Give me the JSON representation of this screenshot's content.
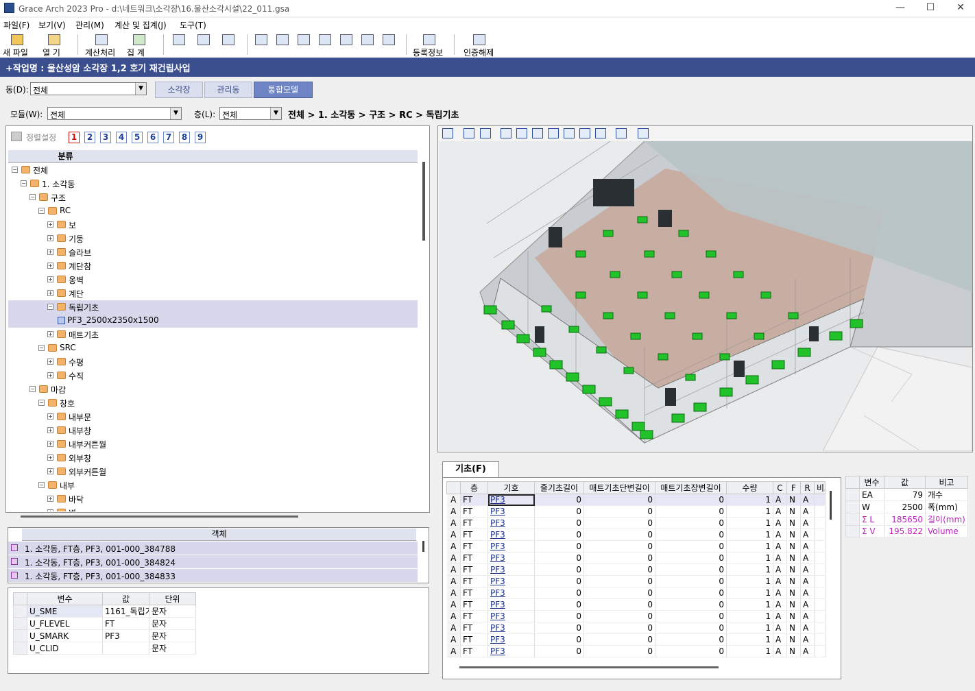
{
  "window": {
    "title": "Grace Arch 2023 Pro - d:\\네트워크\\소각장\\16.울산소각시설\\22_011.gsa",
    "minimize": "—",
    "maximize": "☐",
    "close": "✕"
  },
  "menu": [
    "파일(F)",
    "보기(V)",
    "관리(M)",
    "계산 및 집계(J)",
    "도구(T)"
  ],
  "toolbar": {
    "new_file": "새 파일",
    "open": "열  기",
    "calculate": "계산처리",
    "aggregate": "집  계",
    "register_info": "등록정보",
    "unauthorize": "인증해제"
  },
  "project": "+작업명 : 울산성암 소각장 1,2 호기 재건립사업",
  "building": {
    "label": "동(D):",
    "value": "전체"
  },
  "tabs": [
    "소각장",
    "관리동",
    "통합모델"
  ],
  "active_tab": 2,
  "module": {
    "label": "모듈(W):",
    "value": "전체"
  },
  "floor": {
    "label": "층(L):",
    "value": "전체"
  },
  "breadcrumb": "전체 > 1. 소각동 > 구조 > RC > 독립기초",
  "sort_button": "정렬설정",
  "level_tabs": [
    "1",
    "2",
    "3",
    "4",
    "5",
    "6",
    "7",
    "8",
    "9"
  ],
  "tree": {
    "header": "분류",
    "items": [
      {
        "label": "전체",
        "level": 0,
        "tog": "−",
        "icon": "folder"
      },
      {
        "label": "1. 소각동",
        "level": 1,
        "tog": "−",
        "icon": "folder"
      },
      {
        "label": "구조",
        "level": 2,
        "tog": "−",
        "icon": "folder"
      },
      {
        "label": "RC",
        "level": 3,
        "tog": "−",
        "icon": "folder"
      },
      {
        "label": "보",
        "level": 4,
        "tog": "+",
        "icon": "folder"
      },
      {
        "label": "기둥",
        "level": 4,
        "tog": "+",
        "icon": "folder"
      },
      {
        "label": "슬라브",
        "level": 4,
        "tog": "+",
        "icon": "folder"
      },
      {
        "label": "계단참",
        "level": 4,
        "tog": "+",
        "icon": "folder"
      },
      {
        "label": "옹벽",
        "level": 4,
        "tog": "+",
        "icon": "folder"
      },
      {
        "label": "계단",
        "level": 4,
        "tog": "+",
        "icon": "folder"
      },
      {
        "label": "독립기초",
        "level": 4,
        "tog": "−",
        "icon": "folder",
        "selected": true
      },
      {
        "label": "PF3_2500x2350x1500",
        "level": 5,
        "tog": "",
        "icon": "item",
        "selected": true
      },
      {
        "label": "매트기초",
        "level": 4,
        "tog": "+",
        "icon": "folder"
      },
      {
        "label": "SRC",
        "level": 3,
        "tog": "−",
        "icon": "folder"
      },
      {
        "label": "수평",
        "level": 4,
        "tog": "+",
        "icon": "folder"
      },
      {
        "label": "수직",
        "level": 4,
        "tog": "+",
        "icon": "folder"
      },
      {
        "label": "마감",
        "level": 2,
        "tog": "−",
        "icon": "folder"
      },
      {
        "label": "창호",
        "level": 3,
        "tog": "−",
        "icon": "folder"
      },
      {
        "label": "내부문",
        "level": 4,
        "tog": "+",
        "icon": "folder"
      },
      {
        "label": "내부창",
        "level": 4,
        "tog": "+",
        "icon": "folder"
      },
      {
        "label": "내부커튼월",
        "level": 4,
        "tog": "+",
        "icon": "folder"
      },
      {
        "label": "외부창",
        "level": 4,
        "tog": "+",
        "icon": "folder"
      },
      {
        "label": "외부커튼월",
        "level": 4,
        "tog": "+",
        "icon": "folder"
      },
      {
        "label": "내부",
        "level": 3,
        "tog": "−",
        "icon": "folder"
      },
      {
        "label": "바닥",
        "level": 4,
        "tog": "+",
        "icon": "folder"
      },
      {
        "label": "벽",
        "level": 4,
        "tog": "+",
        "icon": "folder"
      }
    ]
  },
  "objects": {
    "header": "객체",
    "rows": [
      "1. 소각동, FT층, PF3, 001-000_384788",
      "1. 소각동, FT층, PF3, 001-000_384824",
      "1. 소각동, FT층, PF3, 001-000_384833"
    ]
  },
  "variables": {
    "headers": [
      "변수",
      "값",
      "단위"
    ],
    "rows": [
      [
        "U_SME",
        "1161_독립기",
        "문자"
      ],
      [
        "U_FLEVEL",
        "FT",
        "문자"
      ],
      [
        "U_SMARK",
        "PF3",
        "문자"
      ],
      [
        "U_CLID",
        "",
        "문자"
      ]
    ]
  },
  "grid": {
    "tab": "기초(F)",
    "headers": [
      "",
      "층",
      "기호",
      "줄기초길이",
      "매트기초단변길이",
      "매트기초장변길이",
      "수량",
      "C",
      "F",
      "R",
      "비고"
    ],
    "rows": [
      [
        "A",
        "FT",
        "PF3",
        "0",
        "0",
        "0",
        "1",
        "A",
        "N",
        "A"
      ],
      [
        "A",
        "FT",
        "PF3",
        "0",
        "0",
        "0",
        "1",
        "A",
        "N",
        "A"
      ],
      [
        "A",
        "FT",
        "PF3",
        "0",
        "0",
        "0",
        "1",
        "A",
        "N",
        "A"
      ],
      [
        "A",
        "FT",
        "PF3",
        "0",
        "0",
        "0",
        "1",
        "A",
        "N",
        "A"
      ],
      [
        "A",
        "FT",
        "PF3",
        "0",
        "0",
        "0",
        "1",
        "A",
        "N",
        "A"
      ],
      [
        "A",
        "FT",
        "PF3",
        "0",
        "0",
        "0",
        "1",
        "A",
        "N",
        "A"
      ],
      [
        "A",
        "FT",
        "PF3",
        "0",
        "0",
        "0",
        "1",
        "A",
        "N",
        "A"
      ],
      [
        "A",
        "FT",
        "PF3",
        "0",
        "0",
        "0",
        "1",
        "A",
        "N",
        "A"
      ],
      [
        "A",
        "FT",
        "PF3",
        "0",
        "0",
        "0",
        "1",
        "A",
        "N",
        "A"
      ],
      [
        "A",
        "FT",
        "PF3",
        "0",
        "0",
        "0",
        "1",
        "A",
        "N",
        "A"
      ],
      [
        "A",
        "FT",
        "PF3",
        "0",
        "0",
        "0",
        "1",
        "A",
        "N",
        "A"
      ],
      [
        "A",
        "FT",
        "PF3",
        "0",
        "0",
        "0",
        "1",
        "A",
        "N",
        "A"
      ],
      [
        "A",
        "FT",
        "PF3",
        "0",
        "0",
        "0",
        "1",
        "A",
        "N",
        "A"
      ],
      [
        "A",
        "FT",
        "PF3",
        "0",
        "0",
        "0",
        "1",
        "A",
        "N",
        "A"
      ]
    ]
  },
  "summary": {
    "headers": [
      "변수",
      "값",
      "비고"
    ],
    "rows": [
      [
        "EA",
        "79",
        "개수",
        false
      ],
      [
        "W",
        "2500",
        "폭(mm)",
        false
      ],
      [
        "Σ L",
        "185650",
        "길이(mm)",
        true
      ],
      [
        "Σ V",
        "195.822",
        "Volume",
        true
      ]
    ]
  }
}
